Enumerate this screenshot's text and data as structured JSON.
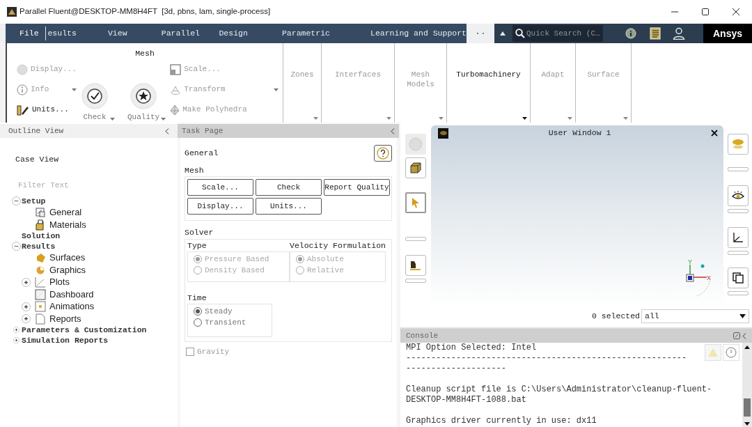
{
  "window": {
    "title": "Parallel Fluent@DESKTOP-MM8H4FT  [3d, pbns, lam, single-process]"
  },
  "menu": [
    "File",
    "esults",
    "View",
    "Parallel",
    "Design",
    "Parametric",
    "Learning and Support"
  ],
  "quick_search": {
    "placeholder": "Quick Search (C…"
  },
  "brand": "Ansys",
  "ribbon": {
    "mesh": {
      "title": "Mesh",
      "left": [
        {
          "label": "Display...",
          "disabled": true
        },
        {
          "label": "Info",
          "disabled": true
        },
        {
          "label": "Units...",
          "disabled": false
        }
      ],
      "large": [
        {
          "label": "Check"
        },
        {
          "label": "Quality"
        }
      ],
      "right": [
        {
          "label": "Scale...",
          "disabled": true
        },
        {
          "label": "Transform",
          "disabled": true
        },
        {
          "label": "Make Polyhedra",
          "disabled": true
        }
      ]
    },
    "groups": [
      {
        "label": "Zones",
        "disabled": true
      },
      {
        "label": "Interfaces",
        "disabled": true
      },
      {
        "label": "Mesh Models",
        "disabled": true
      },
      {
        "label": "Turbomachinery",
        "disabled": false
      },
      {
        "label": "Adapt",
        "disabled": true
      },
      {
        "label": "Surface",
        "disabled": true
      }
    ]
  },
  "outline": {
    "title": "Outline View",
    "case_view": "Case View",
    "filter": {
      "placeholder": "Filter Text"
    },
    "tree": [
      {
        "label": "Setup",
        "expanded": true,
        "children": [
          {
            "label": "General",
            "kind": "form"
          },
          {
            "label": "Materials",
            "kind": "materials"
          }
        ]
      },
      {
        "label": "Solution"
      },
      {
        "label": "Results",
        "expanded": true,
        "children": [
          {
            "label": "Surfaces",
            "kind": "surface"
          },
          {
            "label": "Graphics",
            "kind": "graphics"
          },
          {
            "label": "Plots",
            "kind": "plot",
            "expanded": false
          },
          {
            "label": "Dashboard",
            "kind": "dashboard"
          },
          {
            "label": "Animations",
            "kind": "animation",
            "expanded": false
          },
          {
            "label": "Reports",
            "kind": "report",
            "expanded": false
          }
        ]
      },
      {
        "label": "Parameters & Customization",
        "expanded": false
      },
      {
        "label": "Simulation Reports",
        "expanded": false
      }
    ]
  },
  "task_page": {
    "title": "Task Page",
    "heading": "General",
    "mesh": {
      "title": "Mesh",
      "buttons": [
        "Scale...",
        "Check",
        "Report Quality",
        "Display...",
        "Units..."
      ]
    },
    "solver": {
      "title": "Solver",
      "groups": [
        {
          "title": "Type",
          "disabled": true,
          "options": [
            {
              "label": "Pressure Based",
              "selected": true
            },
            {
              "label": "Density Based",
              "selected": false
            }
          ]
        },
        {
          "title": "Velocity Formulation",
          "disabled": true,
          "options": [
            {
              "label": "Absolute",
              "selected": true
            },
            {
              "label": "Relative",
              "selected": false
            }
          ]
        },
        {
          "title": "Time",
          "disabled": false,
          "options": [
            {
              "label": "Steady",
              "selected": true
            },
            {
              "label": "Transient",
              "selected": false
            }
          ]
        }
      ]
    },
    "gravity": {
      "label": "Gravity",
      "checked": false
    }
  },
  "graphics": {
    "title": "User Window 1",
    "triad": {
      "x": "X",
      "y": "Y"
    },
    "selection": "0 selected",
    "filter": {
      "value": "all"
    }
  },
  "console": {
    "title": "Console",
    "paragraphs": [
      [
        "MPI Option Selected: Intel",
        "--------------------------------------------------------",
        "--------------------"
      ],
      [
        "Cleanup script file is C:\\Users\\Administrator\\cleanup-fluent-",
        "DESKTOP-MM8H4FT-1088.bat"
      ],
      [
        "Graphics driver currently in use: dx11"
      ]
    ]
  }
}
